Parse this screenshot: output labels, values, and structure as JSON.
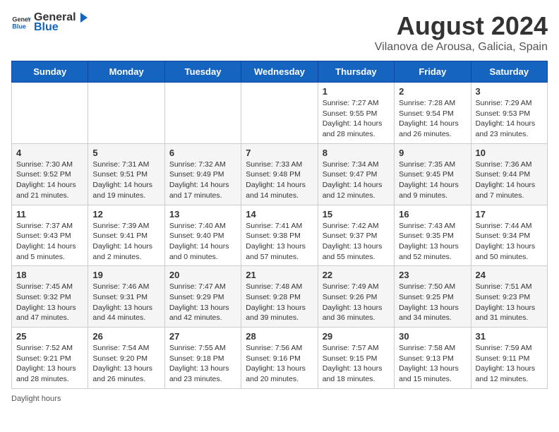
{
  "header": {
    "logo_general": "General",
    "logo_blue": "Blue",
    "title": "August 2024",
    "subtitle": "Vilanova de Arousa, Galicia, Spain"
  },
  "calendar": {
    "days_of_week": [
      "Sunday",
      "Monday",
      "Tuesday",
      "Wednesday",
      "Thursday",
      "Friday",
      "Saturday"
    ],
    "weeks": [
      [
        {
          "day": "",
          "info": ""
        },
        {
          "day": "",
          "info": ""
        },
        {
          "day": "",
          "info": ""
        },
        {
          "day": "",
          "info": ""
        },
        {
          "day": "1",
          "info": "Sunrise: 7:27 AM\nSunset: 9:55 PM\nDaylight: 14 hours and 28 minutes."
        },
        {
          "day": "2",
          "info": "Sunrise: 7:28 AM\nSunset: 9:54 PM\nDaylight: 14 hours and 26 minutes."
        },
        {
          "day": "3",
          "info": "Sunrise: 7:29 AM\nSunset: 9:53 PM\nDaylight: 14 hours and 23 minutes."
        }
      ],
      [
        {
          "day": "4",
          "info": "Sunrise: 7:30 AM\nSunset: 9:52 PM\nDaylight: 14 hours and 21 minutes."
        },
        {
          "day": "5",
          "info": "Sunrise: 7:31 AM\nSunset: 9:51 PM\nDaylight: 14 hours and 19 minutes."
        },
        {
          "day": "6",
          "info": "Sunrise: 7:32 AM\nSunset: 9:49 PM\nDaylight: 14 hours and 17 minutes."
        },
        {
          "day": "7",
          "info": "Sunrise: 7:33 AM\nSunset: 9:48 PM\nDaylight: 14 hours and 14 minutes."
        },
        {
          "day": "8",
          "info": "Sunrise: 7:34 AM\nSunset: 9:47 PM\nDaylight: 14 hours and 12 minutes."
        },
        {
          "day": "9",
          "info": "Sunrise: 7:35 AM\nSunset: 9:45 PM\nDaylight: 14 hours and 9 minutes."
        },
        {
          "day": "10",
          "info": "Sunrise: 7:36 AM\nSunset: 9:44 PM\nDaylight: 14 hours and 7 minutes."
        }
      ],
      [
        {
          "day": "11",
          "info": "Sunrise: 7:37 AM\nSunset: 9:43 PM\nDaylight: 14 hours and 5 minutes."
        },
        {
          "day": "12",
          "info": "Sunrise: 7:39 AM\nSunset: 9:41 PM\nDaylight: 14 hours and 2 minutes."
        },
        {
          "day": "13",
          "info": "Sunrise: 7:40 AM\nSunset: 9:40 PM\nDaylight: 14 hours and 0 minutes."
        },
        {
          "day": "14",
          "info": "Sunrise: 7:41 AM\nSunset: 9:38 PM\nDaylight: 13 hours and 57 minutes."
        },
        {
          "day": "15",
          "info": "Sunrise: 7:42 AM\nSunset: 9:37 PM\nDaylight: 13 hours and 55 minutes."
        },
        {
          "day": "16",
          "info": "Sunrise: 7:43 AM\nSunset: 9:35 PM\nDaylight: 13 hours and 52 minutes."
        },
        {
          "day": "17",
          "info": "Sunrise: 7:44 AM\nSunset: 9:34 PM\nDaylight: 13 hours and 50 minutes."
        }
      ],
      [
        {
          "day": "18",
          "info": "Sunrise: 7:45 AM\nSunset: 9:32 PM\nDaylight: 13 hours and 47 minutes."
        },
        {
          "day": "19",
          "info": "Sunrise: 7:46 AM\nSunset: 9:31 PM\nDaylight: 13 hours and 44 minutes."
        },
        {
          "day": "20",
          "info": "Sunrise: 7:47 AM\nSunset: 9:29 PM\nDaylight: 13 hours and 42 minutes."
        },
        {
          "day": "21",
          "info": "Sunrise: 7:48 AM\nSunset: 9:28 PM\nDaylight: 13 hours and 39 minutes."
        },
        {
          "day": "22",
          "info": "Sunrise: 7:49 AM\nSunset: 9:26 PM\nDaylight: 13 hours and 36 minutes."
        },
        {
          "day": "23",
          "info": "Sunrise: 7:50 AM\nSunset: 9:25 PM\nDaylight: 13 hours and 34 minutes."
        },
        {
          "day": "24",
          "info": "Sunrise: 7:51 AM\nSunset: 9:23 PM\nDaylight: 13 hours and 31 minutes."
        }
      ],
      [
        {
          "day": "25",
          "info": "Sunrise: 7:52 AM\nSunset: 9:21 PM\nDaylight: 13 hours and 28 minutes."
        },
        {
          "day": "26",
          "info": "Sunrise: 7:54 AM\nSunset: 9:20 PM\nDaylight: 13 hours and 26 minutes."
        },
        {
          "day": "27",
          "info": "Sunrise: 7:55 AM\nSunset: 9:18 PM\nDaylight: 13 hours and 23 minutes."
        },
        {
          "day": "28",
          "info": "Sunrise: 7:56 AM\nSunset: 9:16 PM\nDaylight: 13 hours and 20 minutes."
        },
        {
          "day": "29",
          "info": "Sunrise: 7:57 AM\nSunset: 9:15 PM\nDaylight: 13 hours and 18 minutes."
        },
        {
          "day": "30",
          "info": "Sunrise: 7:58 AM\nSunset: 9:13 PM\nDaylight: 13 hours and 15 minutes."
        },
        {
          "day": "31",
          "info": "Sunrise: 7:59 AM\nSunset: 9:11 PM\nDaylight: 13 hours and 12 minutes."
        }
      ]
    ]
  },
  "footer": {
    "note": "Daylight hours"
  }
}
